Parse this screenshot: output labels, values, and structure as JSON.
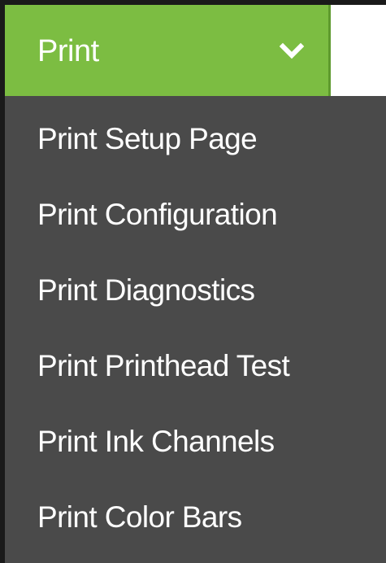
{
  "menu": {
    "title": "Print",
    "toggle_icon": "chevron-down-icon",
    "accent_color": "#7cbd42",
    "panel_color": "#4a4a4a",
    "items": [
      {
        "label": "Print Setup Page"
      },
      {
        "label": "Print Configuration"
      },
      {
        "label": "Print Diagnostics"
      },
      {
        "label": "Print Printhead Test"
      },
      {
        "label": "Print Ink Channels"
      },
      {
        "label": "Print Color Bars"
      }
    ]
  }
}
